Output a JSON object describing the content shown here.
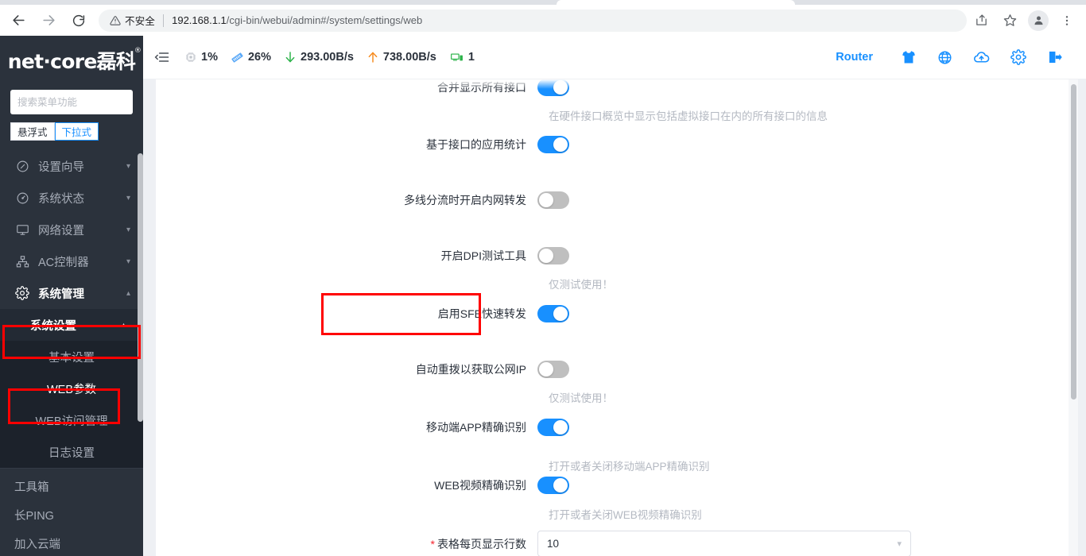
{
  "browser": {
    "back_icon": "back-arrow-icon",
    "forward_icon": "forward-arrow-icon",
    "reload_icon": "reload-icon",
    "security_label": "不安全",
    "url_host": "192.168.1.1",
    "url_path": "/cgi-bin/webui/admin#/system/settings/web",
    "share_icon": "share-icon",
    "bookmark_icon": "star-icon",
    "profile_icon": "profile-avatar-icon",
    "menu_icon": "three-dot-menu-icon"
  },
  "sidebar": {
    "logo": "net·core磊科",
    "logo_sup": "®",
    "search_placeholder": "搜索菜单功能",
    "search_value": "",
    "modes": [
      {
        "label": "悬浮式",
        "active": false
      },
      {
        "label": "下拉式",
        "active": true
      }
    ],
    "menu": [
      {
        "label": "设置向导",
        "icon": "compass-icon",
        "caret": "▾",
        "expanded": false
      },
      {
        "label": "系统状态",
        "icon": "gauge-icon",
        "caret": "▾",
        "expanded": false
      },
      {
        "label": "网络设置",
        "icon": "monitor-icon",
        "caret": "▾",
        "expanded": false
      },
      {
        "label": "AC控制器",
        "icon": "sitemap-icon",
        "caret": "▾",
        "expanded": false
      },
      {
        "label": "系统管理",
        "icon": "gear-icon",
        "caret": "▴",
        "expanded": true
      }
    ],
    "group": {
      "label": "系统设置",
      "caret": "▴"
    },
    "subitems": [
      {
        "label": "基本设置",
        "selected": false
      },
      {
        "label": "WEB参数",
        "selected": true
      },
      {
        "label": "WEB访问管理",
        "selected": false
      },
      {
        "label": "日志设置",
        "selected": false
      }
    ],
    "tools": [
      {
        "label": "工具箱"
      },
      {
        "label": "长PING"
      },
      {
        "label": "加入云端"
      }
    ]
  },
  "header": {
    "hamburger_icon": "menu-collapse-icon",
    "stats": [
      {
        "icon": "cpu-icon",
        "value": "1%"
      },
      {
        "icon": "memory-icon",
        "value": "26%"
      },
      {
        "icon": "download-arrow-icon",
        "value": "293.00B/s"
      },
      {
        "icon": "upload-arrow-icon",
        "value": "738.00B/s"
      },
      {
        "icon": "client-monitor-icon",
        "value": "1"
      }
    ],
    "router_label": "Router",
    "icons": [
      {
        "name": "theme-shirt-icon"
      },
      {
        "name": "language-globe-icon"
      },
      {
        "name": "cloud-upload-icon"
      },
      {
        "name": "settings-gear-icon"
      },
      {
        "name": "logout-icon"
      }
    ]
  },
  "form": {
    "rows": [
      {
        "label": "合并显示所有接口",
        "type": "switch",
        "state": "on",
        "help": "在硬件接口概览中显示包括虚拟接口在内的所有接口的信息"
      },
      {
        "label": "基于接口的应用统计",
        "type": "switch",
        "state": "on",
        "help": ""
      },
      {
        "label": "多线分流时开启内网转发",
        "type": "switch",
        "state": "off",
        "help": ""
      },
      {
        "label": "开启DPI测试工具",
        "type": "switch",
        "state": "off",
        "help": "仅测试使用！"
      },
      {
        "label": "启用SFE快速转发",
        "type": "switch",
        "state": "on",
        "help": "",
        "highlighted": true
      },
      {
        "label": "自动重拨以获取公网IP",
        "type": "switch",
        "state": "off",
        "help": "仅测试使用！"
      },
      {
        "label": "移动端APP精确识别",
        "type": "switch",
        "state": "on",
        "help": "打开或者关闭移动端APP精确识别"
      },
      {
        "label": "WEB视频精确识别",
        "type": "switch",
        "state": "on",
        "help": "打开或者关闭WEB视频精确识别"
      },
      {
        "label": "表格每页显示行数",
        "type": "select",
        "value": "10",
        "required": true,
        "caret": "▾"
      }
    ]
  },
  "colors": {
    "accent": "#1890ff",
    "sidebar_bg": "#2b323c",
    "highlight_red": "#ff0000",
    "switch_off": "#bfbfbf"
  }
}
